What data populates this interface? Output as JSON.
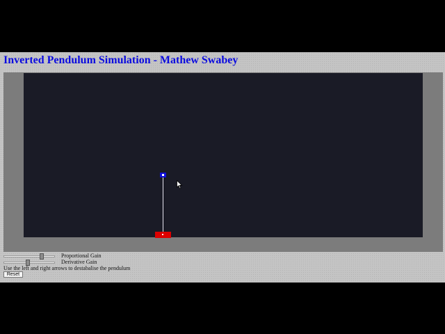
{
  "page": {
    "title": "Inverted Pendulum Simulation - Mathew Swabey"
  },
  "simulation": {
    "colors": {
      "background": "#1a1b26",
      "frame": "#7c7c7c",
      "cart": "#dd0000",
      "bob": "#1010d8",
      "rod": "#e6e6f0"
    },
    "cursor_icon": "mouse-pointer-icon"
  },
  "controls": {
    "proportional_gain": {
      "label": "Proportional Gain",
      "level": 0.75
    },
    "derivative_gain": {
      "label": "Derivative Gain",
      "level": 0.45
    },
    "instructions": "Use the left and right arrows to destabalise the pendulum",
    "reset_label": "Reset"
  }
}
